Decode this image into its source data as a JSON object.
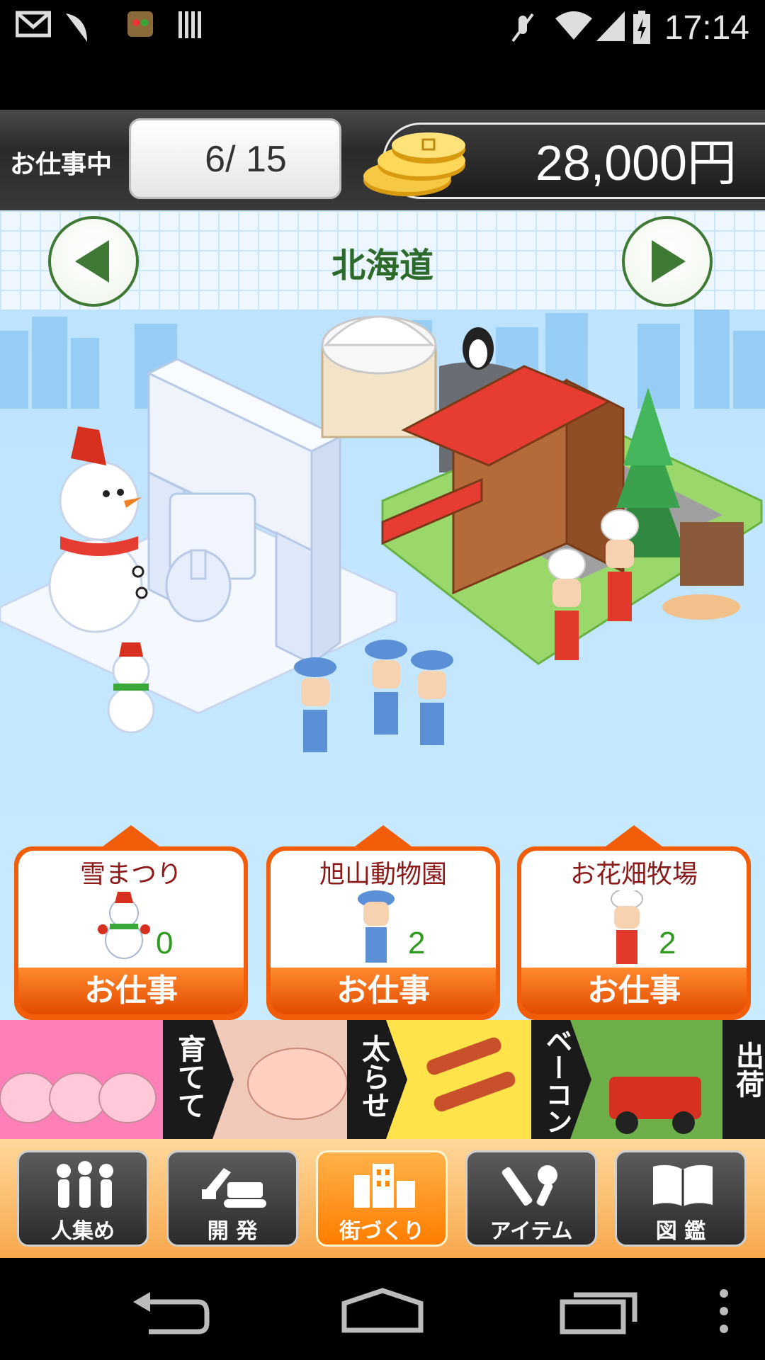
{
  "status_bar": {
    "time": "17:14",
    "icons": [
      "gmail-icon",
      "feather-icon",
      "game-icon",
      "barcode-icon",
      "mute-icon",
      "wifi-icon",
      "signal-icon",
      "battery-icon"
    ]
  },
  "header": {
    "working_label": "お仕事中",
    "job_counter": "6/ 15",
    "money": "28,000円"
  },
  "area_nav": {
    "area_name": "北海道",
    "prev_icon": "left-arrow-icon",
    "next_icon": "right-arrow-icon"
  },
  "jobs": [
    {
      "title": "雪まつり",
      "count": "0",
      "button": "お仕事",
      "figure": "snowman-icon"
    },
    {
      "title": "旭山動物園",
      "count": "2",
      "button": "お仕事",
      "figure": "worker-icon"
    },
    {
      "title": "お花畑牧場",
      "count": "2",
      "button": "お仕事",
      "figure": "chef-icon"
    }
  ],
  "banner": {
    "texts": [
      "育てて",
      "太らせ",
      "ベーコン",
      "出荷"
    ]
  },
  "tabs": [
    {
      "label": "人集め",
      "icon": "people-icon"
    },
    {
      "label": "開 発",
      "icon": "excavator-icon"
    },
    {
      "label": "街づくり",
      "icon": "buildings-icon",
      "active": true
    },
    {
      "label": "アイテム",
      "icon": "tools-icon"
    },
    {
      "label": "図 鑑",
      "icon": "book-icon"
    }
  ],
  "colors": {
    "accent_orange": "#f25d0a",
    "area_green": "#2d6b2a",
    "count_green": "#2f9a1f",
    "title_red": "#8b1a1a"
  }
}
